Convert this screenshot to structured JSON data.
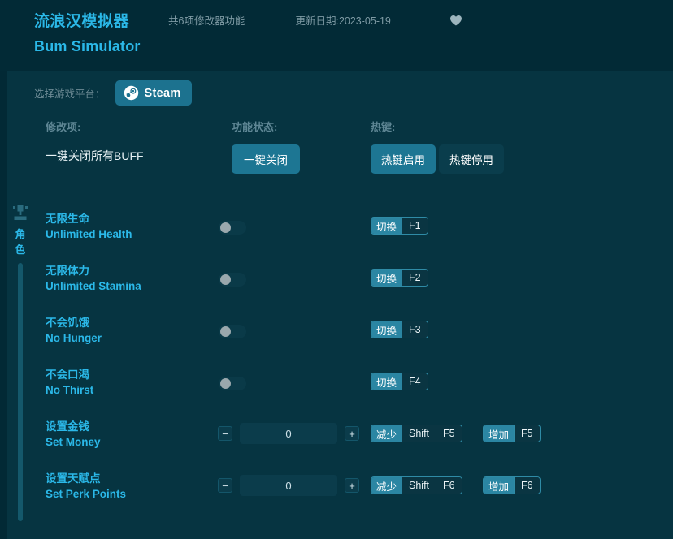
{
  "header": {
    "title_cn": "流浪汉模拟器",
    "title_en": "Bum Simulator",
    "feature_count": "共6项修改器功能",
    "update_date": "更新日期:2023-05-19",
    "favorite_icon": "heart-icon",
    "accent_color": "#2bb8e8",
    "background_color": "#022a36"
  },
  "platform": {
    "label": "选择游戏平台：",
    "selected": "Steam",
    "icon": "steam-icon"
  },
  "columns": {
    "name": "修改项:",
    "state": "功能状态:",
    "hotkey": "热键:"
  },
  "master": {
    "label": "一键关闭所有BUFF",
    "action_label": "一键关闭",
    "hotkey_enable": "热键启用",
    "hotkey_disable": "热键停用"
  },
  "category": {
    "name_cn": "角色",
    "icon": "character-icon"
  },
  "rows": [
    {
      "cn": "无限生命",
      "en": "Unlimited Health",
      "control": "toggle",
      "toggle_on": false,
      "hotkeys": [
        {
          "action": "切换",
          "keys": [
            "F1"
          ]
        }
      ]
    },
    {
      "cn": "无限体力",
      "en": "Unlimited Stamina",
      "control": "toggle",
      "toggle_on": false,
      "hotkeys": [
        {
          "action": "切换",
          "keys": [
            "F2"
          ]
        }
      ]
    },
    {
      "cn": "不会饥饿",
      "en": "No Hunger",
      "control": "toggle",
      "toggle_on": false,
      "hotkeys": [
        {
          "action": "切换",
          "keys": [
            "F3"
          ]
        }
      ]
    },
    {
      "cn": "不会口渴",
      "en": "No Thirst",
      "control": "toggle",
      "toggle_on": false,
      "hotkeys": [
        {
          "action": "切换",
          "keys": [
            "F4"
          ]
        }
      ]
    },
    {
      "cn": "设置金钱",
      "en": "Set Money",
      "control": "stepper",
      "value": "0",
      "minus_label": "−",
      "plus_label": "+",
      "hotkeys": [
        {
          "action": "减少",
          "keys": [
            "Shift",
            "F5"
          ]
        },
        {
          "action": "增加",
          "keys": [
            "F5"
          ]
        }
      ]
    },
    {
      "cn": "设置天赋点",
      "en": "Set Perk Points",
      "control": "stepper",
      "value": "0",
      "minus_label": "−",
      "plus_label": "+",
      "hotkeys": [
        {
          "action": "减少",
          "keys": [
            "Shift",
            "F6"
          ]
        },
        {
          "action": "增加",
          "keys": [
            "F6"
          ]
        }
      ]
    }
  ]
}
